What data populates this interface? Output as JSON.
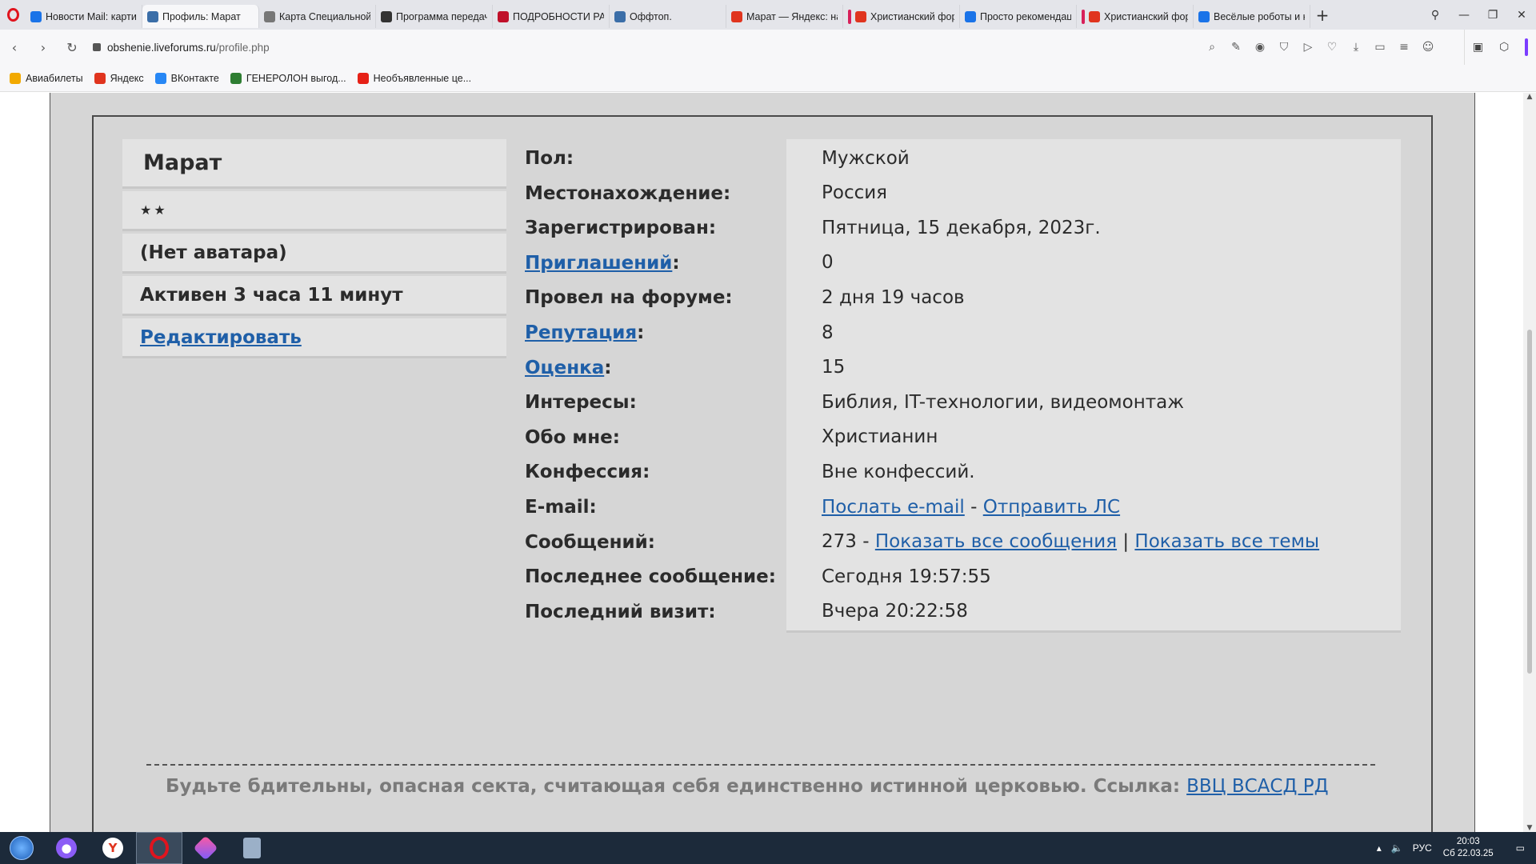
{
  "browser": {
    "tabs": [
      {
        "label": "Новости Mail: картин",
        "fav_color": "#1a73e8"
      },
      {
        "label": "Профиль: Марат",
        "fav_color": "#3b6ea8",
        "active": true
      },
      {
        "label": "Карта Специальной в",
        "fav_color": "#777777"
      },
      {
        "label": "Программа передач",
        "fav_color": "#333333"
      },
      {
        "label": "ПОДРОБНОСТИ РАЗГ",
        "fav_color": "#c0102a"
      },
      {
        "label": "Оффтоп.",
        "fav_color": "#3b6ea8"
      },
      {
        "label": "Марат — Яндекс: нашл",
        "fav_color": "#e0341e"
      },
      {
        "label": "Христианский форум",
        "fav_color": "#e0341e"
      },
      {
        "label": "Просто рекомендаци",
        "fav_color": "#1a73e8"
      },
      {
        "label": "Христианский форум",
        "fav_color": "#e0341e"
      },
      {
        "label": "Весёлые роботы и не",
        "fav_color": "#1a73e8"
      }
    ],
    "new_tab": "+",
    "url_host": "obshenie.liveforums.ru",
    "url_path": "/profile.php",
    "bookmarks": [
      {
        "label": "Авиабилеты",
        "color": "#f2a900"
      },
      {
        "label": "Яндекс",
        "color": "#e0341e"
      },
      {
        "label": "ВКонтакте",
        "color": "#2787f5"
      },
      {
        "label": "ГЕНЕРОЛОН выгод...",
        "color": "#2e7d32"
      },
      {
        "label": "Необъявленные це...",
        "color": "#e62117"
      }
    ]
  },
  "profile": {
    "name": "Марат",
    "stars": "★★",
    "avatar": "(Нет аватара)",
    "active": "Активен 3 часа 11 минут",
    "edit_link": "Редактировать",
    "fields": [
      {
        "label": "Пол:",
        "value": "Мужской"
      },
      {
        "label": "Местонахождение:",
        "value": "Россия"
      },
      {
        "label": "Зарегистрирован:",
        "value": "Пятница, 15 декабря, 2023г."
      },
      {
        "label_link": "Приглашений",
        "label_suffix": ":",
        "value": "0"
      },
      {
        "label": "Провел на форуме:",
        "value": "2 дня 19 часов"
      },
      {
        "label_link": "Репутация",
        "label_suffix": ":",
        "value": "8"
      },
      {
        "label_link": "Оценка",
        "label_suffix": ":",
        "value": "15"
      },
      {
        "label": "Интересы:",
        "value": "Библия, IT-технологии, видеомонтаж"
      },
      {
        "label": "Обо мне:",
        "value": "Христианин"
      },
      {
        "label": "Конфессия:",
        "value": "Вне конфессий."
      },
      {
        "label": "E-mail:",
        "value_link1": "Послать e-mail",
        "value_sep": " - ",
        "value_link2": "Отправить ЛС"
      },
      {
        "label": "Сообщений:",
        "value_prefix": "273 - ",
        "value_link1": "Показать все сообщения",
        "value_sep": " | ",
        "value_link2": "Показать все темы"
      },
      {
        "label": "Последнее сообщение:",
        "value": "Сегодня 19:57:55"
      },
      {
        "label": "Последний визит:",
        "value": "Вчера 20:22:58"
      }
    ]
  },
  "footer": {
    "text": "Будьте бдительны, опасная секта, считающая себя единственно истинной церковью. Ссылка: ",
    "link": "ВВЦ ВСАСД РД"
  },
  "taskbar": {
    "lang": "РУС",
    "time": "20:03",
    "date": "Сб 22.03.25"
  }
}
